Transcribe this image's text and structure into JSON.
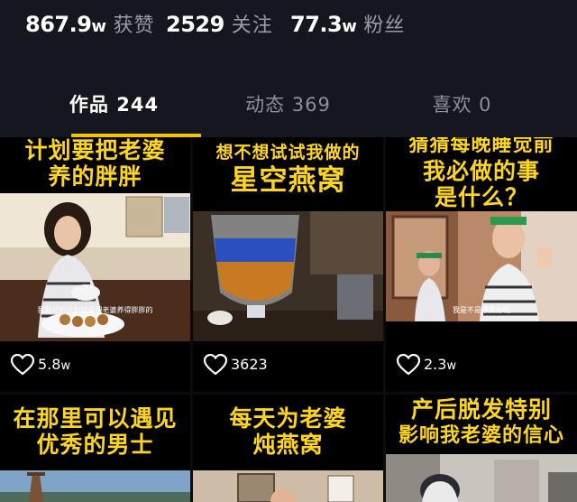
{
  "stats": [
    {
      "number": "867.9",
      "unit": "w",
      "label": "获赞"
    },
    {
      "number": "2529",
      "unit": "",
      "label": "关注"
    },
    {
      "number": "77.3",
      "unit": "w",
      "label": "粉丝"
    }
  ],
  "tabs": [
    {
      "label": "作品 244",
      "active": true
    },
    {
      "label": "动态 369",
      "active": false
    },
    {
      "label": "喜欢 0",
      "active": false
    }
  ],
  "videos": [
    {
      "caption_line1": "计划要把老婆",
      "caption_line2": "养的胖胖",
      "subtitle": "我最近的计划就是把老婆养得胖胖的",
      "likes": "5.8",
      "likes_unit": "w"
    },
    {
      "caption_line1": "想不想试试我做的",
      "caption_line2": "星空燕窝",
      "subtitle": "",
      "likes": "3623",
      "likes_unit": ""
    },
    {
      "caption_line1": "猜猜每晚睡觉前",
      "caption_line2": "我必做的事",
      "caption_line3": "是什么？",
      "subtitle": "我是不是很爱你啊",
      "likes": "2.3",
      "likes_unit": "w"
    },
    {
      "caption_line1": "在那里可以遇见",
      "caption_line2": "优秀的男士"
    },
    {
      "caption_line1": "每天为老婆",
      "caption_line2": "炖燕窝"
    },
    {
      "caption_line1": "产后脱发特别",
      "caption_line2": "影响我老婆的信心"
    }
  ],
  "colors": {
    "accent": "#f5c400",
    "caption": "#ffd61f",
    "background": "#15161e"
  },
  "icons": {
    "like": "heart-outline-icon"
  }
}
